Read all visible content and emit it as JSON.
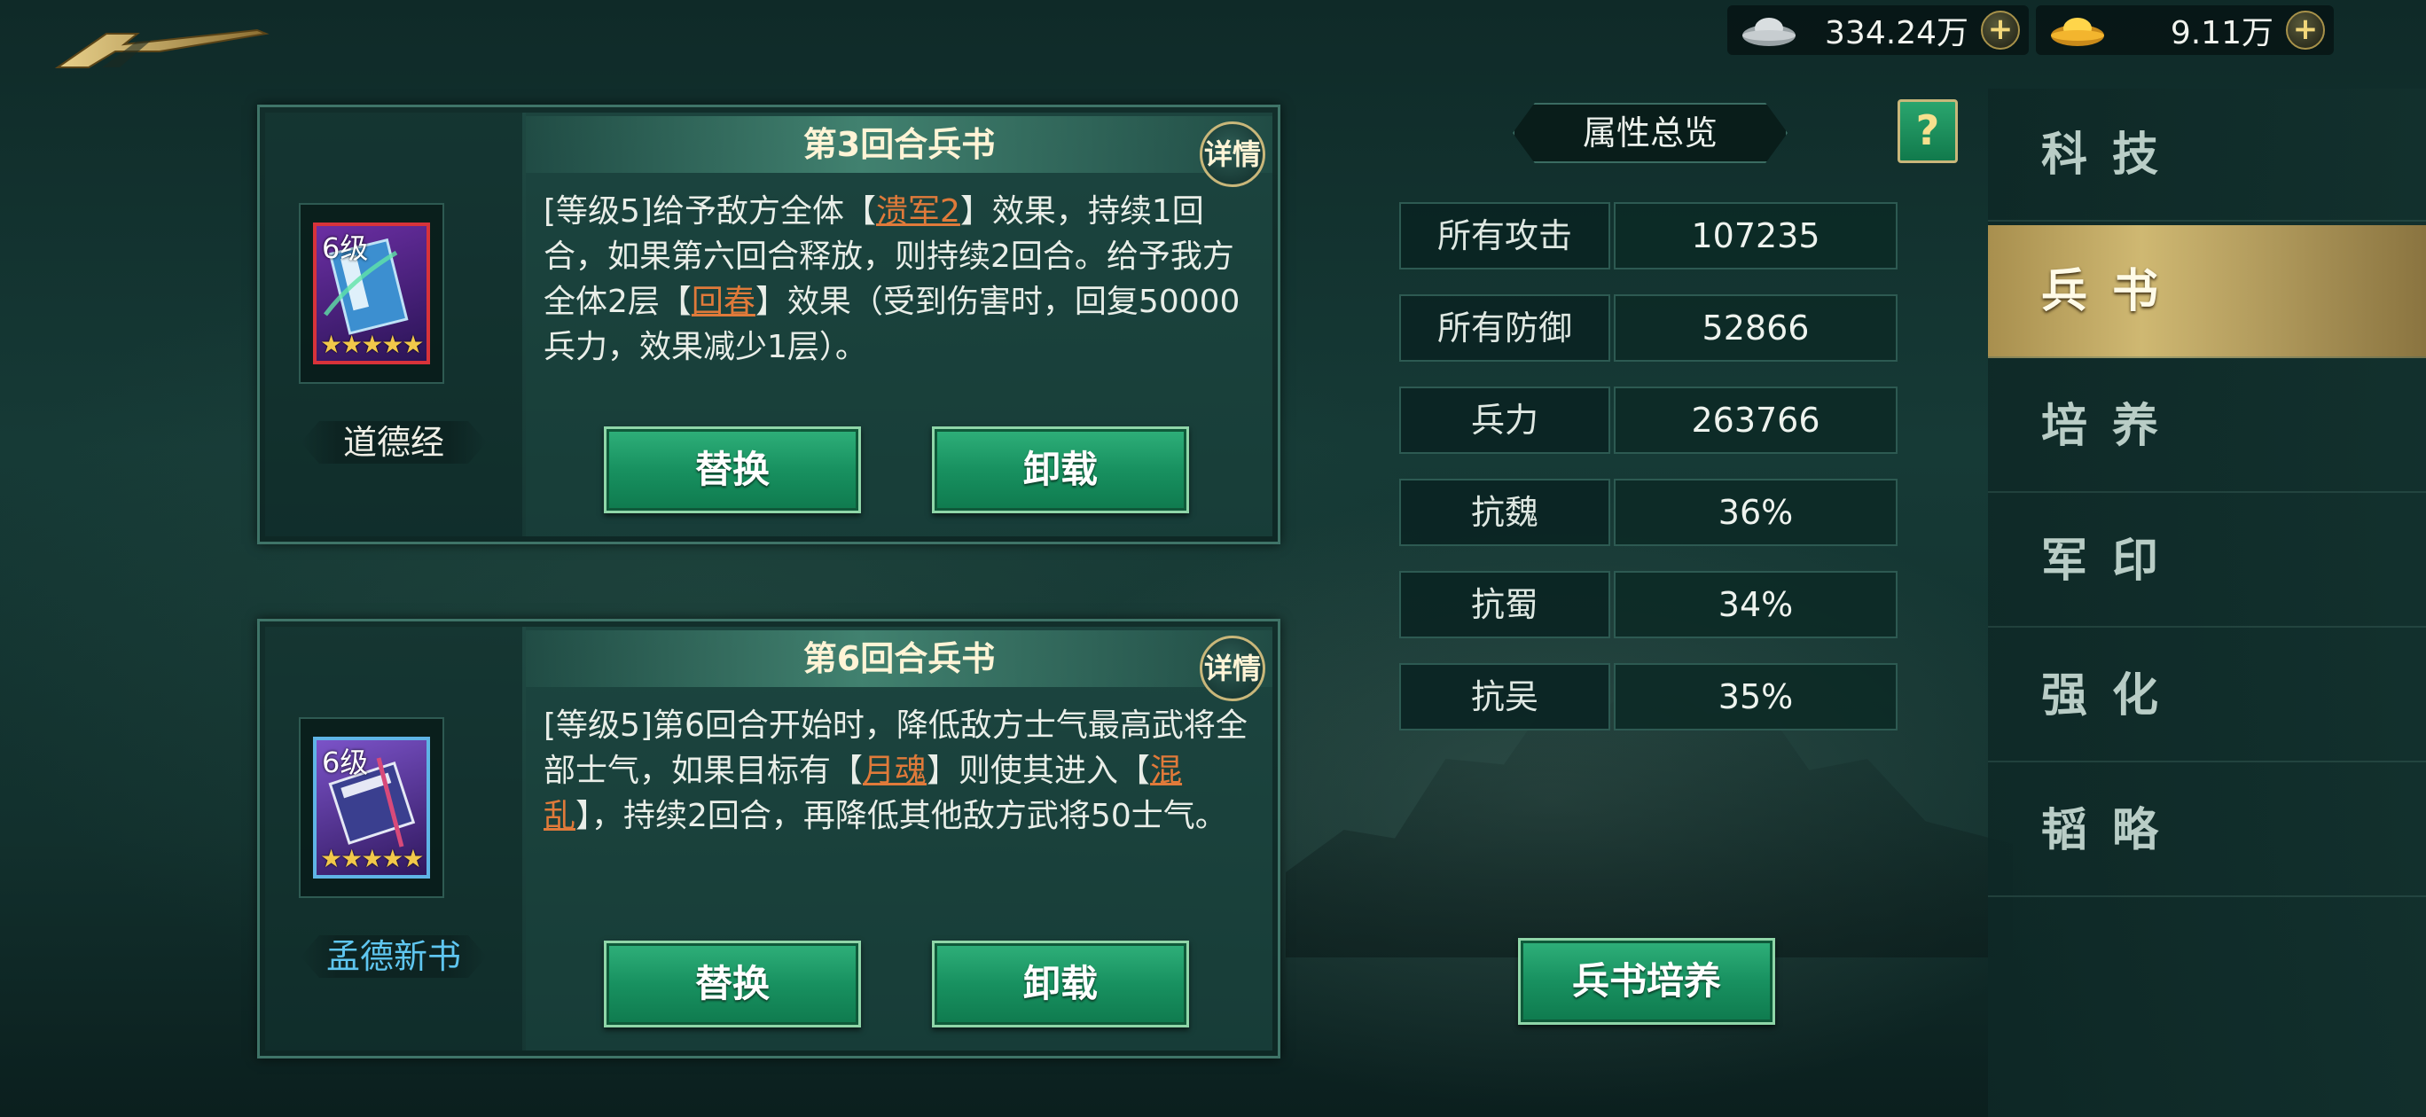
{
  "currency": [
    {
      "icon": "silver-ingot-icon",
      "value": "334.24万"
    },
    {
      "icon": "gold-ingot-icon",
      "value": "9.11万"
    }
  ],
  "cards": [
    {
      "title": "第3回合兵书",
      "detail_label": "详情",
      "level": "6级",
      "stars": "★★★★★",
      "book_name": "道德经",
      "book_name_color": "#f0efe6",
      "desc": {
        "p1": "[等级5]给予敌方全体【",
        "kw1": "溃军2",
        "p2": "】效果，持续1回合，如果第六回合释放，则持续2回合。给予我方全体2层【",
        "kw2": "回春",
        "p3": "】效果（受到伤害时，回复50000兵力，效果减少1层）。"
      },
      "replace_label": "替换",
      "unload_label": "卸载"
    },
    {
      "title": "第6回合兵书",
      "detail_label": "详情",
      "level": "6级",
      "stars": "★★★★★",
      "book_name": "孟德新书",
      "book_name_color": "#5fc6f0",
      "desc": {
        "p1": "[等级5]第6回合开始时，降低敌方士气最高武将全部士气，如果目标有【",
        "kw1": "月魂",
        "p2": "】则使其进入【",
        "kw2": "混乱",
        "p3": "】，持续2回合，再降低其他敌方武将50士气。"
      },
      "replace_label": "替换",
      "unload_label": "卸载"
    }
  ],
  "attributes": {
    "title": "属性总览",
    "help": "?",
    "rows": [
      {
        "label": "所有攻击",
        "value": "107235"
      },
      {
        "label": "所有防御",
        "value": "52866"
      },
      {
        "label": "兵力",
        "value": "263766"
      },
      {
        "label": "抗魏",
        "value": "36%"
      },
      {
        "label": "抗蜀",
        "value": "34%"
      },
      {
        "label": "抗吴",
        "value": "35%"
      }
    ],
    "cultivate_label": "兵书培养"
  },
  "nav": {
    "items": [
      {
        "label": "科技",
        "active": false
      },
      {
        "label": "兵书",
        "active": true
      },
      {
        "label": "培养",
        "active": false
      },
      {
        "label": "军印",
        "active": false
      },
      {
        "label": "强化",
        "active": false
      },
      {
        "label": "韬略",
        "active": false
      }
    ]
  },
  "colors": {
    "keyword": "#e07a3a",
    "accent_gold": "#c9b77a",
    "button_green": "#189160"
  }
}
